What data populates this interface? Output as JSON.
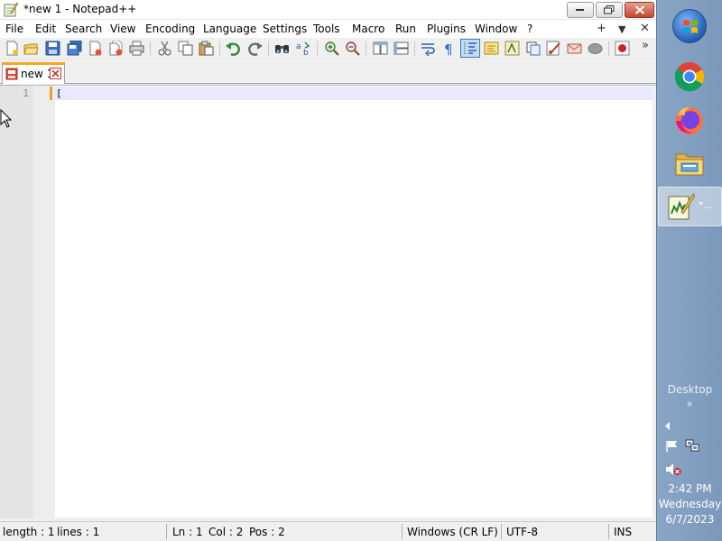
{
  "window": {
    "title": "*new 1 - Notepad++",
    "controls": [
      "minimize",
      "maximize",
      "close"
    ]
  },
  "menubar": {
    "items": [
      "File",
      "Edit",
      "Search",
      "View",
      "Encoding",
      "Language",
      "Settings",
      "Tools",
      "Macro",
      "Run",
      "Plugins",
      "Window",
      "?"
    ],
    "right": [
      "+",
      "▼",
      "✕"
    ]
  },
  "toolbar": {
    "icons": [
      "new-file-icon",
      "open-file-icon",
      "save-icon",
      "save-all-icon",
      "close-icon",
      "close-all-icon",
      "print-icon",
      "cut-icon",
      "copy-icon",
      "paste-icon",
      "undo-icon",
      "redo-icon",
      "find-icon",
      "replace-icon",
      "zoom-in-icon",
      "zoom-out-icon",
      "sync-vertical-icon",
      "sync-horizontal-icon",
      "word-wrap-icon",
      "show-all-chars-icon",
      "indent-guide-icon",
      "doc-map-icon",
      "function-list-icon",
      "folder-workspace-icon",
      "monitoring-icon",
      "macro-record-icon",
      "macro-stop-icon",
      "macro-play-icon",
      "record-icon"
    ],
    "overflow": "»"
  },
  "tabs": [
    {
      "label": "new 1",
      "modified": true,
      "active": true
    }
  ],
  "editor": {
    "line_numbers": [
      "1"
    ],
    "lines": [
      "["
    ]
  },
  "statusbar": {
    "length": "length : 1",
    "lines": "lines : 1",
    "ln": "Ln : 1",
    "col": "Col : 2",
    "pos": "Pos : 2",
    "eol": "Windows (CR LF)",
    "encoding": "UTF-8",
    "mode": "INS"
  },
  "taskbar": {
    "pinned": [
      "windows-start-icon",
      "chrome-icon",
      "firefox-icon",
      "file-explorer-icon",
      "notepadpp-icon"
    ],
    "active_task_label": "*...",
    "desktop_label": "Desktop",
    "desktop_chevron": "»",
    "clock": {
      "time": "2:42 PM",
      "day": "Wednesday",
      "date": "6/7/2023"
    }
  },
  "colors": {
    "tab_accent": "#f5a623",
    "caret_line": "#e8e8ff",
    "change_marker": "#f59d1e",
    "taskbar": "#7b98bb"
  }
}
